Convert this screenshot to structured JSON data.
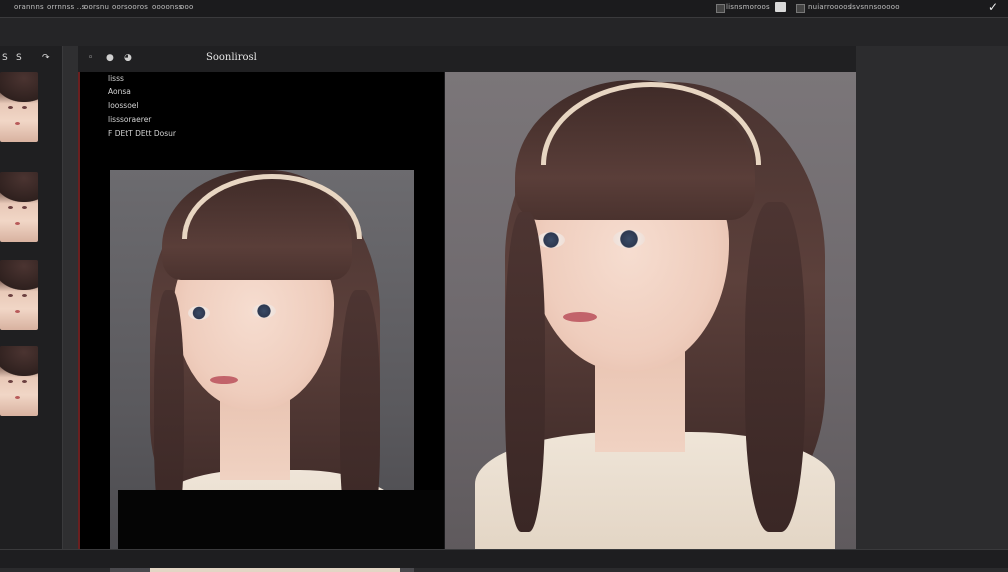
{
  "menubar": {
    "items": [
      "orannns",
      "orrnnss ..s",
      "oorsnu",
      "oorsooros",
      "oooonss",
      "ooo"
    ],
    "right_items": [
      "lisnsmoroos",
      "nuiarroooos",
      "lsvsnnsooooo"
    ]
  },
  "sidebar": {
    "tab_1": "S",
    "tab_2": "S",
    "tab_3": "↷"
  },
  "panel": {
    "icons": [
      "◦",
      "●",
      "◕"
    ],
    "title": "Soonlirosl"
  },
  "layers": {
    "items": [
      "lisss",
      "Aonsa",
      "Ioossoel",
      "lisssoraerer",
      "F DEtT DEtt Dosur"
    ]
  },
  "status": {
    "check": "✓"
  }
}
